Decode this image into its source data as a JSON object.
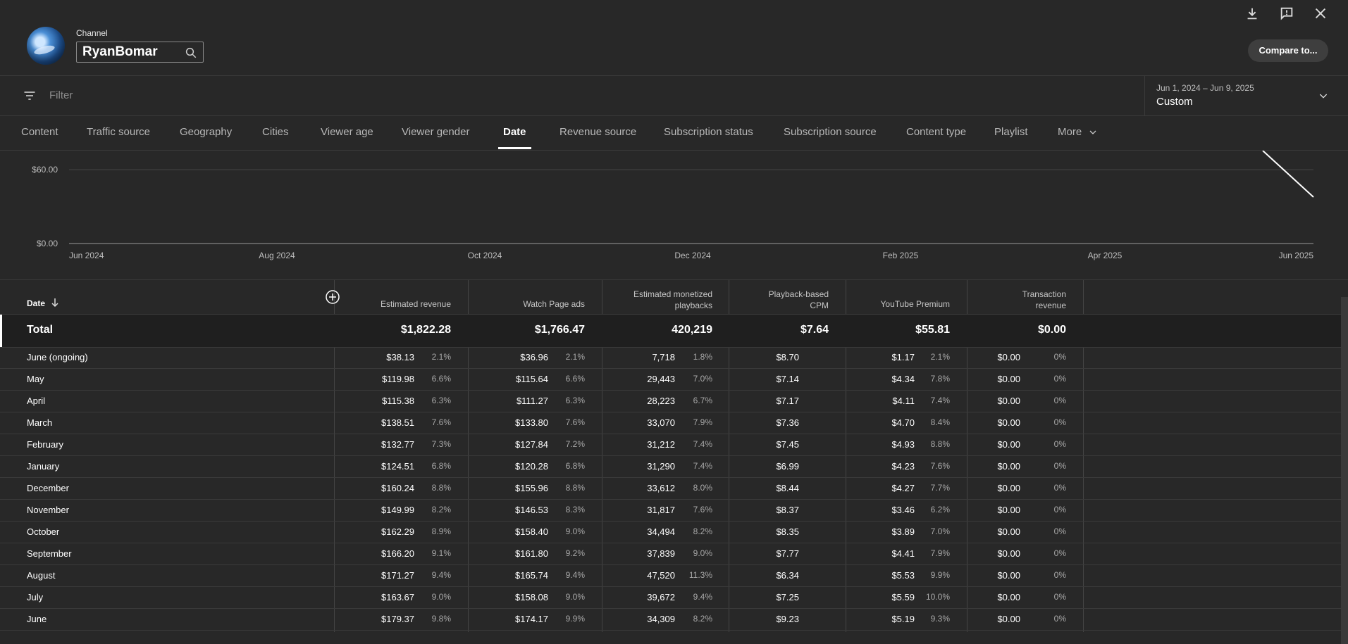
{
  "header": {
    "channel_label": "Channel",
    "channel_name": "RyanBomar",
    "compare_button": "Compare to..."
  },
  "filter": {
    "placeholder": "Filter",
    "date_range": "Jun 1, 2024 – Jun 9, 2025",
    "date_label": "Custom"
  },
  "tabs": [
    {
      "label": "Content"
    },
    {
      "label": "Traffic source"
    },
    {
      "label": "Geography"
    },
    {
      "label": "Cities"
    },
    {
      "label": "Viewer age"
    },
    {
      "label": "Viewer gender"
    },
    {
      "label": "Date"
    },
    {
      "label": "Revenue source"
    },
    {
      "label": "Subscription status"
    },
    {
      "label": "Subscription source"
    },
    {
      "label": "Content type"
    },
    {
      "label": "Playlist"
    },
    {
      "label": "More"
    }
  ],
  "active_tab": "Date",
  "chart_data": {
    "type": "line",
    "y_ticks": [
      "$60.00",
      "$0.00"
    ],
    "x_ticks": [
      "Jun 2024",
      "Aug 2024",
      "Oct 2024",
      "Dec 2024",
      "Feb 2025",
      "Apr 2025",
      "Jun 2025"
    ],
    "grid": true
  },
  "table": {
    "date_header": "Date",
    "columns": [
      {
        "label": "Estimated revenue"
      },
      {
        "label": "Watch Page ads"
      },
      {
        "label": "Estimated monetized playbacks"
      },
      {
        "label": "Playback-based CPM"
      },
      {
        "label": "YouTube Premium"
      },
      {
        "label": "Transaction revenue"
      }
    ],
    "total": {
      "label": "Total",
      "values": [
        "$1,822.28",
        "$1,766.47",
        "420,219",
        "$7.64",
        "$55.81",
        "$0.00"
      ]
    },
    "rows": [
      {
        "label": "June (ongoing)",
        "cells": [
          [
            "$38.13",
            "2.1%"
          ],
          [
            "$36.96",
            "2.1%"
          ],
          [
            "7,718",
            "1.8%"
          ],
          [
            "$8.70",
            ""
          ],
          [
            "$1.17",
            "2.1%"
          ],
          [
            "$0.00",
            "0%"
          ]
        ]
      },
      {
        "label": "May",
        "cells": [
          [
            "$119.98",
            "6.6%"
          ],
          [
            "$115.64",
            "6.6%"
          ],
          [
            "29,443",
            "7.0%"
          ],
          [
            "$7.14",
            ""
          ],
          [
            "$4.34",
            "7.8%"
          ],
          [
            "$0.00",
            "0%"
          ]
        ]
      },
      {
        "label": "April",
        "cells": [
          [
            "$115.38",
            "6.3%"
          ],
          [
            "$111.27",
            "6.3%"
          ],
          [
            "28,223",
            "6.7%"
          ],
          [
            "$7.17",
            ""
          ],
          [
            "$4.11",
            "7.4%"
          ],
          [
            "$0.00",
            "0%"
          ]
        ]
      },
      {
        "label": "March",
        "cells": [
          [
            "$138.51",
            "7.6%"
          ],
          [
            "$133.80",
            "7.6%"
          ],
          [
            "33,070",
            "7.9%"
          ],
          [
            "$7.36",
            ""
          ],
          [
            "$4.70",
            "8.4%"
          ],
          [
            "$0.00",
            "0%"
          ]
        ]
      },
      {
        "label": "February",
        "cells": [
          [
            "$132.77",
            "7.3%"
          ],
          [
            "$127.84",
            "7.2%"
          ],
          [
            "31,212",
            "7.4%"
          ],
          [
            "$7.45",
            ""
          ],
          [
            "$4.93",
            "8.8%"
          ],
          [
            "$0.00",
            "0%"
          ]
        ]
      },
      {
        "label": "January",
        "cells": [
          [
            "$124.51",
            "6.8%"
          ],
          [
            "$120.28",
            "6.8%"
          ],
          [
            "31,290",
            "7.4%"
          ],
          [
            "$6.99",
            ""
          ],
          [
            "$4.23",
            "7.6%"
          ],
          [
            "$0.00",
            "0%"
          ]
        ]
      },
      {
        "label": "December",
        "cells": [
          [
            "$160.24",
            "8.8%"
          ],
          [
            "$155.96",
            "8.8%"
          ],
          [
            "33,612",
            "8.0%"
          ],
          [
            "$8.44",
            ""
          ],
          [
            "$4.27",
            "7.7%"
          ],
          [
            "$0.00",
            "0%"
          ]
        ]
      },
      {
        "label": "November",
        "cells": [
          [
            "$149.99",
            "8.2%"
          ],
          [
            "$146.53",
            "8.3%"
          ],
          [
            "31,817",
            "7.6%"
          ],
          [
            "$8.37",
            ""
          ],
          [
            "$3.46",
            "6.2%"
          ],
          [
            "$0.00",
            "0%"
          ]
        ]
      },
      {
        "label": "October",
        "cells": [
          [
            "$162.29",
            "8.9%"
          ],
          [
            "$158.40",
            "9.0%"
          ],
          [
            "34,494",
            "8.2%"
          ],
          [
            "$8.35",
            ""
          ],
          [
            "$3.89",
            "7.0%"
          ],
          [
            "$0.00",
            "0%"
          ]
        ]
      },
      {
        "label": "September",
        "cells": [
          [
            "$166.20",
            "9.1%"
          ],
          [
            "$161.80",
            "9.2%"
          ],
          [
            "37,839",
            "9.0%"
          ],
          [
            "$7.77",
            ""
          ],
          [
            "$4.41",
            "7.9%"
          ],
          [
            "$0.00",
            "0%"
          ]
        ]
      },
      {
        "label": "August",
        "cells": [
          [
            "$171.27",
            "9.4%"
          ],
          [
            "$165.74",
            "9.4%"
          ],
          [
            "47,520",
            "11.3%"
          ],
          [
            "$6.34",
            ""
          ],
          [
            "$5.53",
            "9.9%"
          ],
          [
            "$0.00",
            "0%"
          ]
        ]
      },
      {
        "label": "July",
        "cells": [
          [
            "$163.67",
            "9.0%"
          ],
          [
            "$158.08",
            "9.0%"
          ],
          [
            "39,672",
            "9.4%"
          ],
          [
            "$7.25",
            ""
          ],
          [
            "$5.59",
            "10.0%"
          ],
          [
            "$0.00",
            "0%"
          ]
        ]
      },
      {
        "label": "June",
        "cells": [
          [
            "$179.37",
            "9.8%"
          ],
          [
            "$174.17",
            "9.9%"
          ],
          [
            "34,309",
            "8.2%"
          ],
          [
            "$9.23",
            ""
          ],
          [
            "$5.19",
            "9.3%"
          ],
          [
            "$0.00",
            "0%"
          ]
        ]
      }
    ]
  }
}
